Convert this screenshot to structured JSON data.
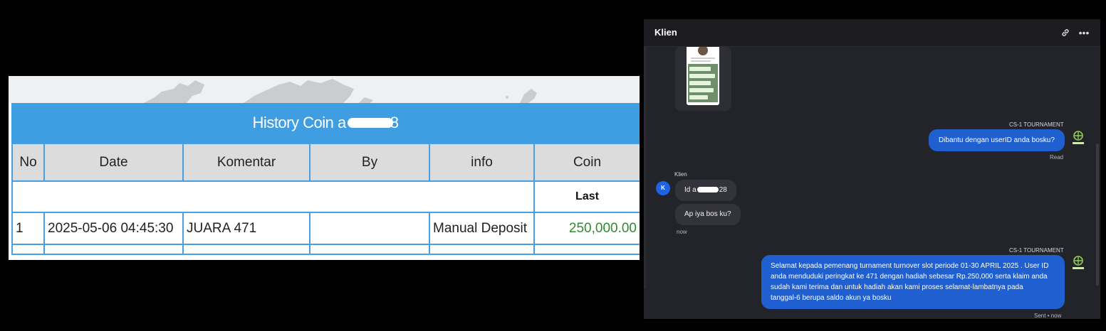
{
  "history": {
    "title_prefix": "History Coin a",
    "title_suffix": "8",
    "columns": [
      "No",
      "Date",
      "Komentar",
      "By",
      "info",
      "Coin"
    ],
    "last_label": "Last",
    "rows": [
      {
        "no": "1",
        "date": "2025-05-06 04:45:30",
        "komentar": "JUARA 471",
        "by": "",
        "info": "Manual Deposit",
        "coin": "250,000.00"
      }
    ],
    "colors": {
      "header_blue": "#3f9de2",
      "border_blue": "#4d9ede",
      "coin_green": "#2e8b2e"
    }
  },
  "chat": {
    "title": "Klien",
    "header_icons": [
      "link-icon",
      "more-icon"
    ],
    "messages": [
      {
        "sender": "CS-1 TOURNAMENT",
        "text": "Dibantu dengan userID anda bosku?",
        "status": "Read"
      },
      {
        "sender": "Klien",
        "avatar": "K",
        "text_prefix": "Id a",
        "text_suffix": "28",
        "text2": "Ap iya bos ku?",
        "time": "now"
      },
      {
        "sender": "CS-1 TOURNAMENT",
        "lines": [
          "Selamat kepada pemenang turnament turnover slot periode 01-30 APRIL 2025 . User ID",
          "anda menduduki peringkat ke 471 dengan hadiah sebesar Rp.250,000 serta klaim anda",
          "sudah kami terima dan untuk hadiah akan kami proses selamat-lambatnya pada",
          "tanggal-6 berupa saldo akun ya bosku"
        ],
        "status": "Sent • now"
      }
    ],
    "colors": {
      "outgoing_bubble": "#1f5fcf",
      "incoming_bubble": "#33333b",
      "panel_bg": "#23232a"
    }
  }
}
